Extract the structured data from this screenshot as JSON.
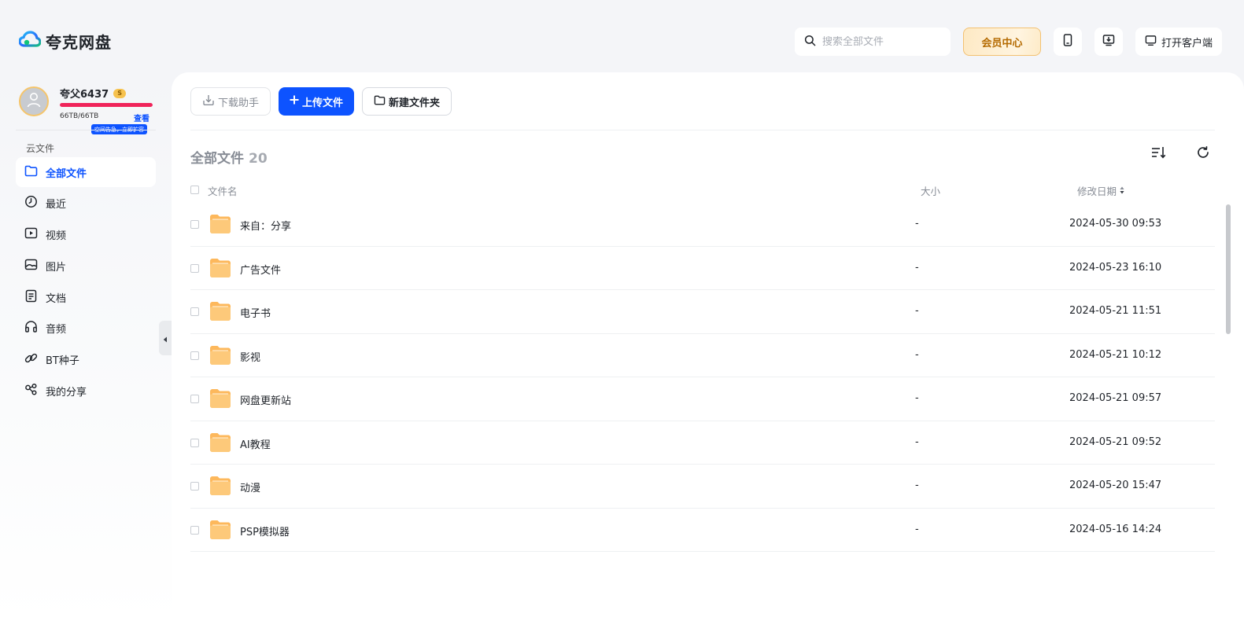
{
  "app": {
    "logo_text": "夸克网盘"
  },
  "header": {
    "search_placeholder": "搜索全部文件",
    "vip_label": "会员中心",
    "client_label": "打开客户端"
  },
  "user": {
    "name": "夸父6437",
    "vip_badge": "S",
    "storage_text": "66TB/66TB",
    "storage_used_fraction": 1.0,
    "view_link": "查看",
    "tip": "空间告急，立即扩容"
  },
  "sidebar": {
    "section_label": "云文件",
    "items": [
      {
        "label": "全部文件",
        "icon": "folder-icon"
      },
      {
        "label": "最近",
        "icon": "clock-icon"
      },
      {
        "label": "视频",
        "icon": "video-icon"
      },
      {
        "label": "图片",
        "icon": "image-icon"
      },
      {
        "label": "文档",
        "icon": "document-icon"
      },
      {
        "label": "音频",
        "icon": "headphones-icon"
      },
      {
        "label": "BT种子",
        "icon": "link-icon"
      },
      {
        "label": "我的分享",
        "icon": "share-icon"
      }
    ]
  },
  "toolbar": {
    "download_helper": "下载助手",
    "upload": "上传文件",
    "new_folder": "新建文件夹"
  },
  "files": {
    "title": "全部文件",
    "count": "20",
    "columns": {
      "name": "文件名",
      "size": "大小",
      "date": "修改日期"
    },
    "rows": [
      {
        "name": "来自：分享",
        "size": "-",
        "date": "2024-05-30 09:53"
      },
      {
        "name": "广告文件",
        "size": "-",
        "date": "2024-05-23 16:10"
      },
      {
        "name": "电子书",
        "size": "-",
        "date": "2024-05-21 11:51"
      },
      {
        "name": "影视",
        "size": "-",
        "date": "2024-05-21 10:12"
      },
      {
        "name": "网盘更新站",
        "size": "-",
        "date": "2024-05-21 09:57"
      },
      {
        "name": "AI教程",
        "size": "-",
        "date": "2024-05-21 09:52"
      },
      {
        "name": "动漫",
        "size": "-",
        "date": "2024-05-20 15:47"
      },
      {
        "name": "PSP模拟器",
        "size": "-",
        "date": "2024-05-16 14:24"
      }
    ]
  },
  "colors": {
    "brand": "#0d53ff",
    "storage_full": "#f0245a",
    "folder": "#fdc26f",
    "vip_text": "#b46a00"
  }
}
